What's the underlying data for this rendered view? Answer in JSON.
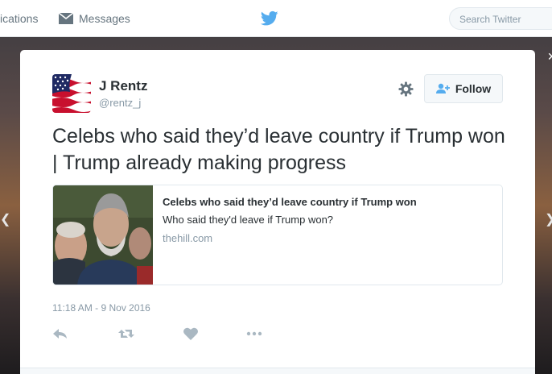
{
  "nav": {
    "notifications_label": "ications",
    "messages_label": "Messages",
    "search_placeholder": "Search Twitter"
  },
  "tweet": {
    "author_name": "J Rentz",
    "author_handle": "@rentz_j",
    "follow_label": "Follow",
    "text": "Celebs who said they’d leave country if Trump won | Trump already making progress",
    "timestamp": "11:18 AM - 9 Nov 2016"
  },
  "link_card": {
    "title": "Celebs who said they’d leave country if Trump won",
    "description": "Who said they'd leave if Trump won?",
    "domain": "thehill.com"
  },
  "colors": {
    "twitter_blue": "#55acee",
    "text_primary": "#292f33",
    "text_secondary": "#8899a6",
    "icon_gray": "#66757f",
    "action_gray": "#aab8c2"
  },
  "icons": {
    "messages": "envelope-icon",
    "logo": "twitter-bird-icon",
    "settings": "gear-icon",
    "follow": "follow-user-icon",
    "reply": "reply-icon",
    "retweet": "retweet-icon",
    "like": "heart-icon",
    "more": "more-dots-icon"
  }
}
